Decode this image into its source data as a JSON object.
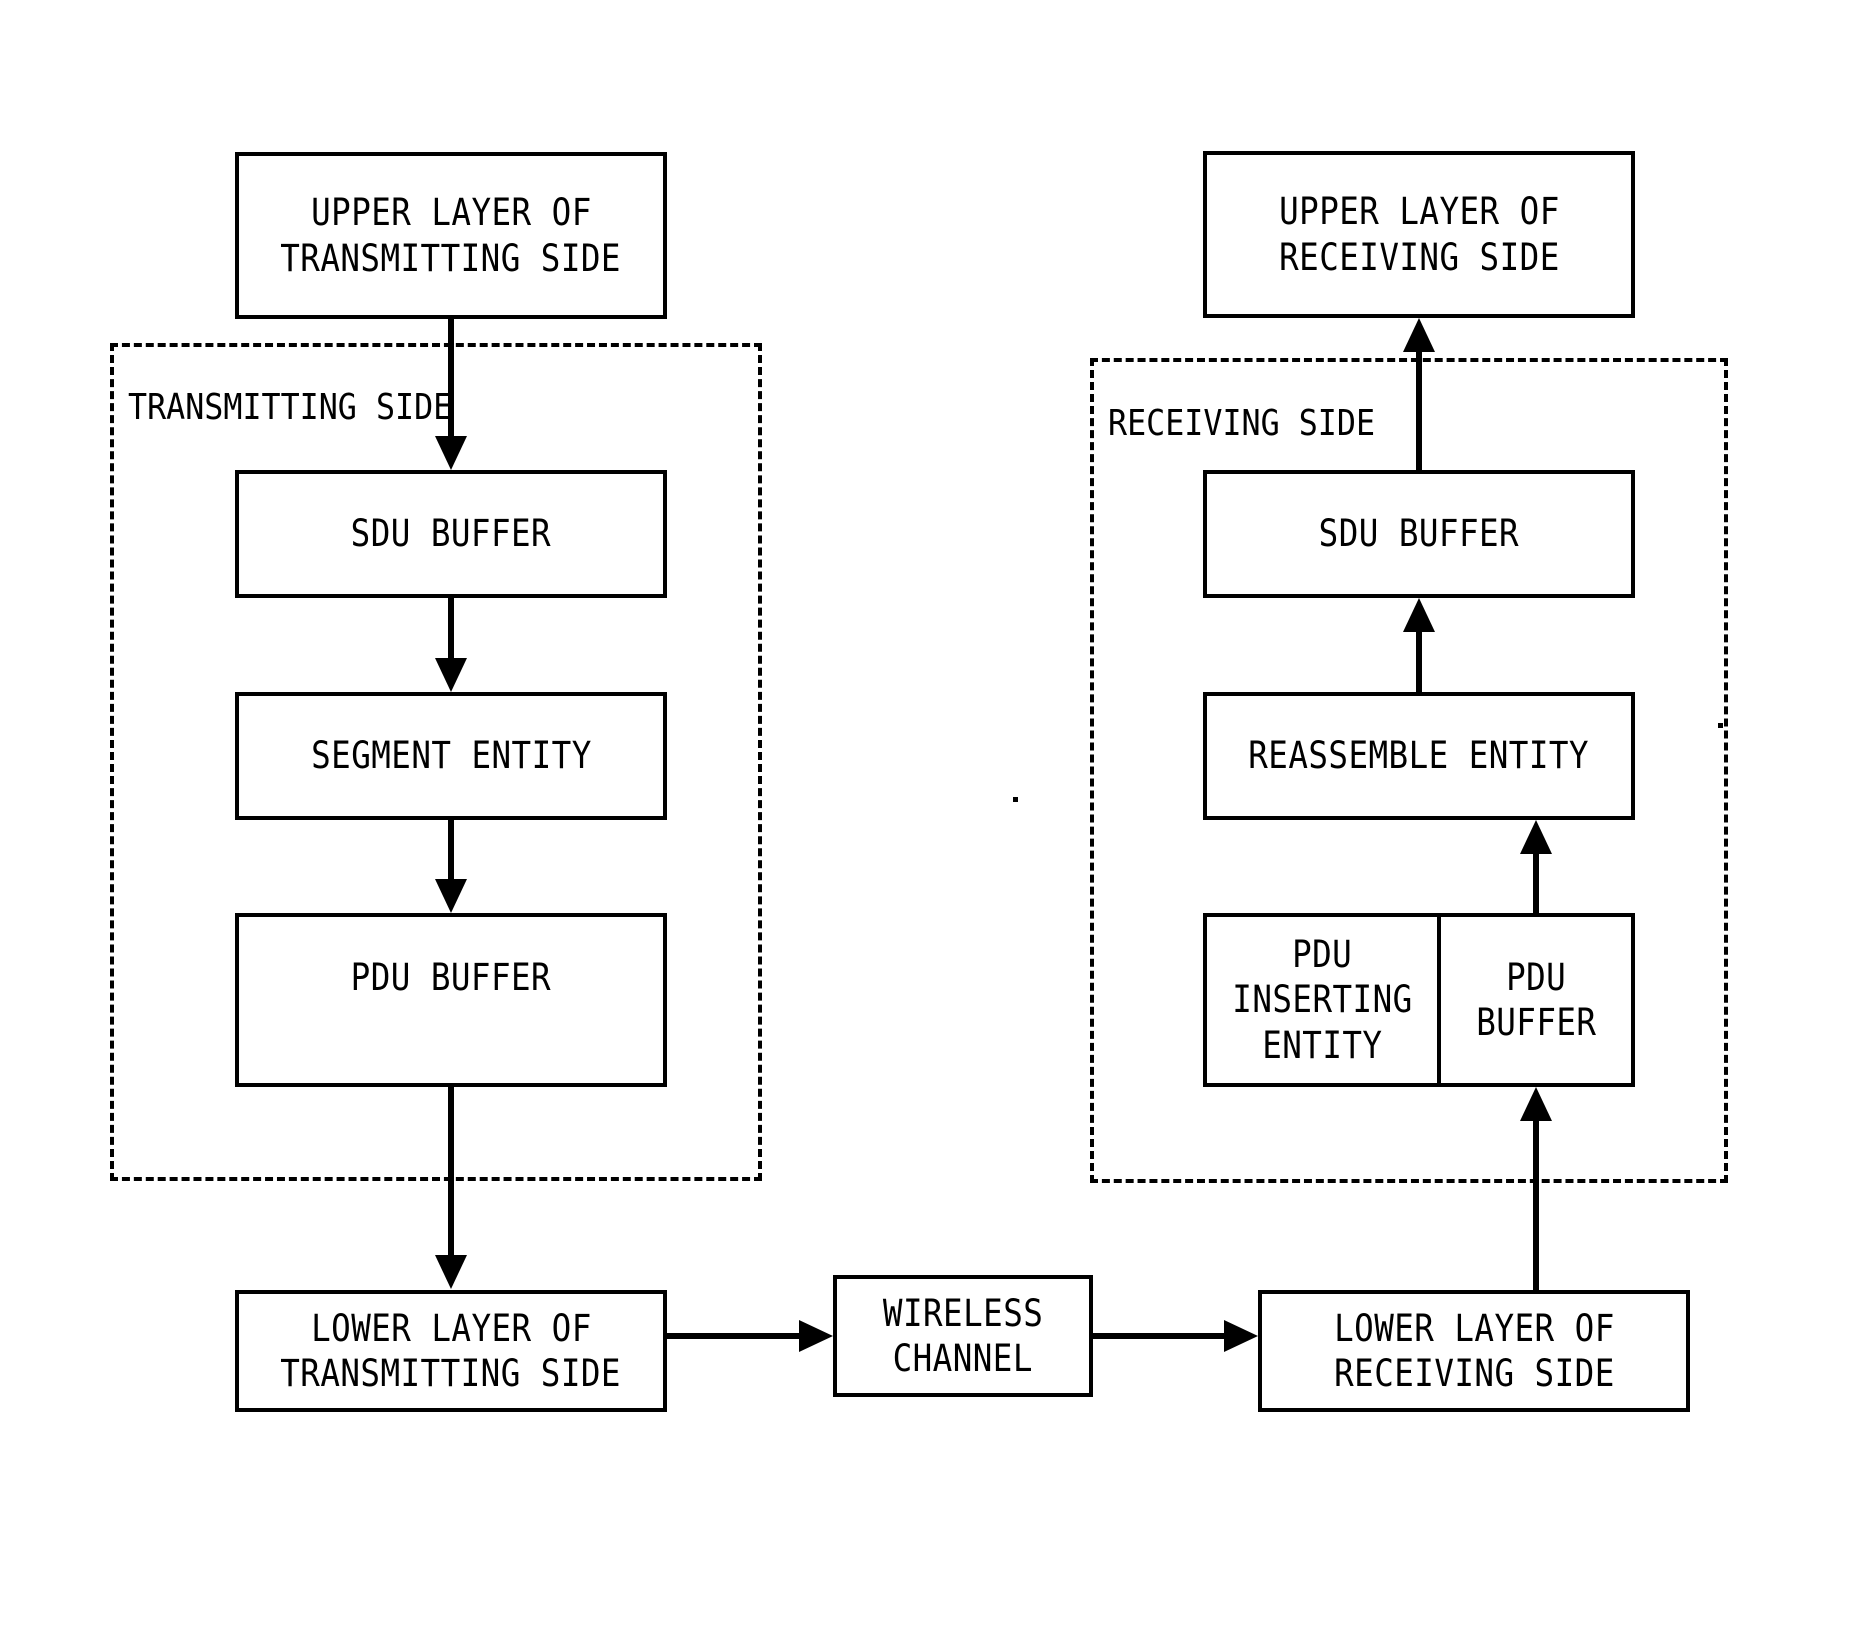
{
  "figure": {
    "type": "block-diagram",
    "background_color": "#ffffff",
    "line_color": "#000000"
  },
  "groups": {
    "transmitting": {
      "label": "TRANSMITTING SIDE"
    },
    "receiving": {
      "label": "RECEIVING SIDE"
    }
  },
  "blocks": {
    "upper_tx": {
      "line1": "UPPER LAYER OF",
      "line2": "TRANSMITTING SIDE"
    },
    "sdu_tx": {
      "line1": "SDU BUFFER"
    },
    "segment": {
      "line1": "SEGMENT ENTITY"
    },
    "pdu_tx": {
      "line1": "PDU BUFFER"
    },
    "lower_tx": {
      "line1": "LOWER LAYER OF",
      "line2": "TRANSMITTING SIDE"
    },
    "channel": {
      "line1": "WIRELESS",
      "line2": "CHANNEL"
    },
    "lower_rx": {
      "line1": "LOWER LAYER OF",
      "line2": "RECEIVING SIDE"
    },
    "pdu_insert": {
      "line1": "PDU",
      "line2": "INSERTING",
      "line3": "ENTITY"
    },
    "pdu_rx": {
      "line1": "PDU",
      "line2": "BUFFER"
    },
    "reassemble": {
      "line1": "REASSEMBLE ENTITY"
    },
    "sdu_rx": {
      "line1": "SDU BUFFER"
    },
    "upper_rx": {
      "line1": "UPPER LAYER OF",
      "line2": "RECEIVING SIDE"
    }
  }
}
